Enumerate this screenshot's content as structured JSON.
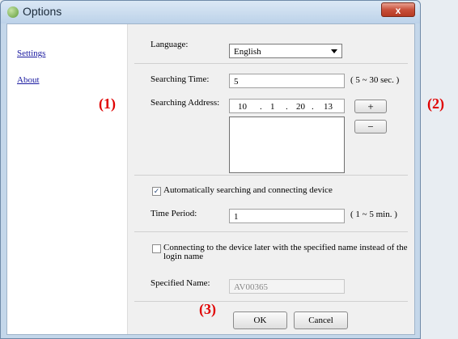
{
  "window": {
    "title": "Options",
    "close_label": "x"
  },
  "sidebar": {
    "items": [
      {
        "label": "Settings"
      },
      {
        "label": "About"
      }
    ]
  },
  "language": {
    "label": "Language:",
    "value": "English"
  },
  "searching_time": {
    "label": "Searching Time:",
    "value": "5",
    "hint": "( 5 ~ 30 sec. )"
  },
  "searching_address": {
    "label": "Searching Address:",
    "octets": [
      "10",
      "1",
      "20",
      "13"
    ],
    "separator": ".",
    "add_label": "+",
    "remove_label": "−"
  },
  "auto_search": {
    "label": "Automatically searching and connecting device",
    "checked": true,
    "check_mark": "✓"
  },
  "time_period": {
    "label": "Time Period:",
    "value": "1",
    "hint": "( 1 ~ 5 min. )"
  },
  "specified_name_option": {
    "label_line1": "Connecting to the device later with the specified name instead of the",
    "label_line2": "login name",
    "checked": false
  },
  "specified_name": {
    "label": "Specified Name:",
    "value": "AV00365"
  },
  "buttons": {
    "ok": "OK",
    "cancel": "Cancel"
  },
  "callouts": {
    "one": "(1)",
    "two": "(2)",
    "three": "(3)"
  }
}
